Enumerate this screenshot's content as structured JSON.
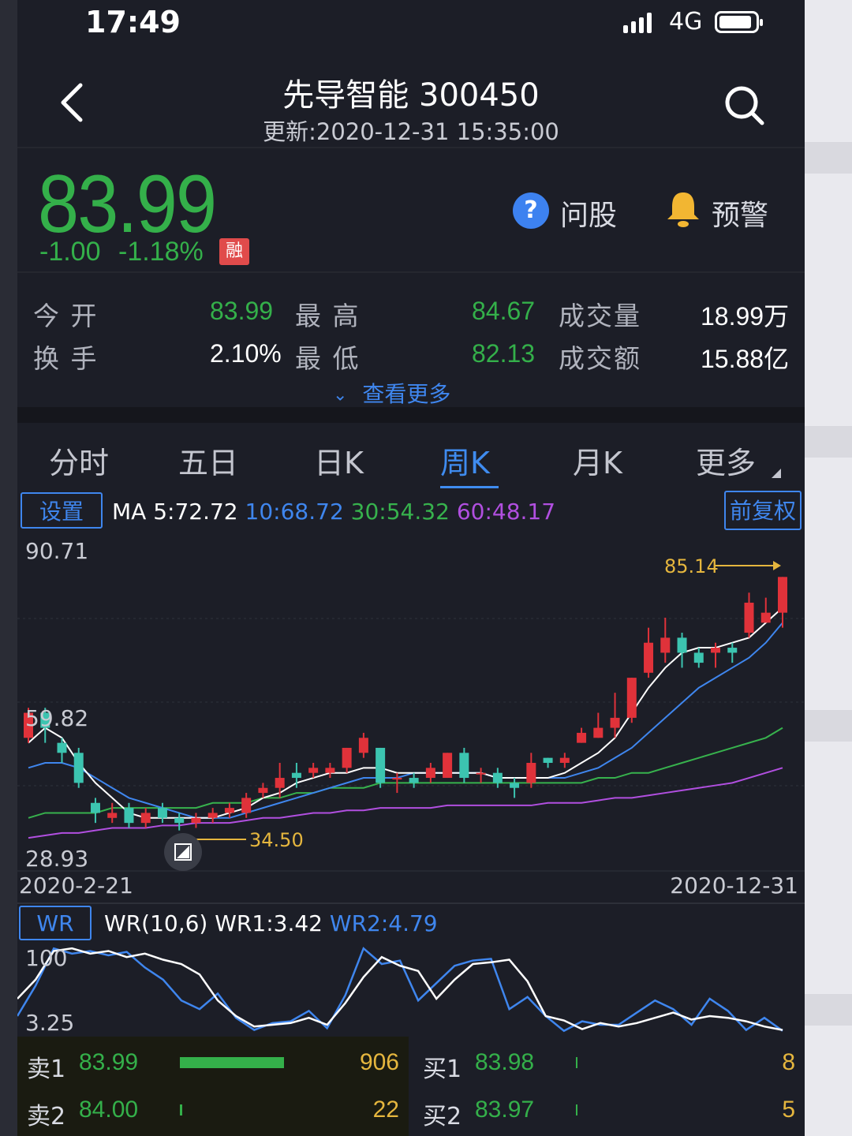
{
  "status_bar": {
    "time": "17:49",
    "network": "4G"
  },
  "header": {
    "title": "先导智能 300450",
    "updated": "更新:2020-12-31 15:35:00"
  },
  "quote": {
    "price": "83.99",
    "change": "-1.00",
    "change_pct": "-1.18%",
    "margin_badge": "融",
    "color_down": "#34b04a"
  },
  "actions": {
    "ask_icon": "?",
    "ask_label": "问股",
    "alert_label": "预警"
  },
  "stats": [
    {
      "label": "今 开",
      "value": "83.99"
    },
    {
      "label": "最 高",
      "value": "84.67"
    },
    {
      "label": "成交量",
      "value": "18.99万"
    },
    {
      "label": "换 手",
      "value": "2.10%"
    },
    {
      "label": "最 低",
      "value": "82.13"
    },
    {
      "label": "成交额",
      "value": "15.88亿"
    }
  ],
  "see_more": "查看更多",
  "tabs": [
    "分时",
    "五日",
    "日K",
    "周K",
    "月K",
    "更多"
  ],
  "active_tab": "周K",
  "toolbar": {
    "settings_label": "设置",
    "adjust_label": "前复权"
  },
  "ma": {
    "prefix": "MA",
    "ma5": "5:72.72",
    "ma10": "10:68.72",
    "ma30": "30:54.32",
    "ma60": "60:48.17",
    "colors": {
      "ma5": "#ffffff",
      "ma10": "#3f86ee",
      "ma30": "#37b24d",
      "ma60": "#b14fe0"
    }
  },
  "chart_data": {
    "type": "candlestick",
    "y_max_label": "90.71",
    "y_mid_label": "59.82",
    "y_min_label": "28.93",
    "ylim": [
      28.93,
      90.71
    ],
    "x_start": "2020-2-21",
    "x_end": "2020-12-31",
    "max_marker": "85.14",
    "min_marker": "34.50",
    "up_color": "#e0323a",
    "down_color": "#3cc4b0",
    "candles": [
      [
        53,
        58,
        52,
        59
      ],
      [
        58,
        55,
        52,
        59
      ],
      [
        52,
        50,
        48,
        53
      ],
      [
        50,
        44,
        43,
        51
      ],
      [
        40,
        38,
        36,
        41
      ],
      [
        37,
        38,
        36,
        40
      ],
      [
        39,
        36,
        35,
        40
      ],
      [
        36,
        38,
        35,
        39
      ],
      [
        39,
        37,
        36,
        40
      ],
      [
        37,
        36,
        34.5,
        38
      ],
      [
        36,
        37,
        35,
        38
      ],
      [
        37,
        38,
        36,
        39
      ],
      [
        38,
        39,
        37,
        40
      ],
      [
        38,
        41,
        37,
        42
      ],
      [
        42,
        43,
        41,
        44
      ],
      [
        43,
        45,
        41,
        48
      ],
      [
        46,
        45,
        43,
        48
      ],
      [
        46,
        47,
        45,
        48
      ],
      [
        46,
        47,
        45,
        48
      ],
      [
        47,
        51,
        46,
        51
      ],
      [
        50,
        53,
        49,
        54
      ],
      [
        51,
        44,
        43,
        51
      ],
      [
        45,
        45,
        42,
        46
      ],
      [
        45,
        44,
        43,
        46
      ],
      [
        45,
        47,
        44,
        48
      ],
      [
        45,
        50,
        45,
        50
      ],
      [
        50,
        45,
        44,
        51
      ],
      [
        46,
        46,
        44,
        47
      ],
      [
        46,
        44,
        43,
        47
      ],
      [
        44,
        43,
        41,
        45
      ],
      [
        44,
        48,
        43,
        50
      ],
      [
        49,
        48,
        47,
        49
      ],
      [
        48,
        49,
        47,
        50
      ],
      [
        52,
        54,
        52,
        55
      ],
      [
        53,
        55,
        53,
        58
      ],
      [
        55,
        57,
        53,
        62
      ],
      [
        57,
        65,
        56,
        65
      ],
      [
        66,
        72,
        65,
        75
      ],
      [
        70,
        73,
        68,
        77
      ],
      [
        73,
        70,
        67,
        74
      ],
      [
        70,
        68,
        67,
        71
      ],
      [
        70,
        71,
        67,
        72
      ],
      [
        71,
        70,
        68,
        72
      ],
      [
        74,
        80,
        73,
        82
      ],
      [
        76,
        78,
        76,
        81
      ],
      [
        78,
        85.14,
        75,
        85.14
      ]
    ],
    "ma5": [
      52,
      55,
      53,
      48,
      44,
      41,
      38,
      37,
      37,
      37,
      37,
      37,
      38,
      39,
      41,
      42,
      44,
      45,
      46,
      46,
      47,
      47,
      46,
      46,
      46,
      46,
      46,
      46,
      45,
      45,
      45,
      45,
      46,
      48,
      50,
      53,
      58,
      63,
      67,
      70,
      71,
      71,
      72,
      73,
      76,
      79
    ],
    "ma10": [
      47,
      48,
      48,
      47,
      45,
      43,
      41,
      40,
      39,
      38,
      37,
      37,
      37,
      38,
      39,
      40,
      41,
      42,
      43,
      44,
      45,
      45,
      45,
      46,
      46,
      46,
      46,
      46,
      45,
      45,
      45,
      45,
      45,
      46,
      47,
      49,
      51,
      54,
      57,
      60,
      63,
      65,
      67,
      69,
      72,
      76
    ],
    "ma30": [
      37,
      38,
      38,
      38,
      38,
      39,
      39,
      39,
      39,
      39,
      39,
      40,
      40,
      40,
      41,
      41,
      42,
      42,
      43,
      43,
      43,
      44,
      44,
      44,
      44,
      44,
      44,
      44,
      44,
      44,
      44,
      44,
      44,
      44,
      45,
      45,
      46,
      46,
      47,
      48,
      49,
      50,
      51,
      52,
      53,
      55
    ],
    "ma60": [
      33,
      33.5,
      34,
      34,
      34.5,
      35,
      35,
      35,
      35.5,
      35.5,
      36,
      36,
      36,
      36.5,
      37,
      37,
      37.5,
      38,
      38,
      38.5,
      38.5,
      39,
      39,
      39,
      39,
      39.5,
      39.5,
      39.5,
      39.5,
      39.5,
      39.5,
      40,
      40,
      40,
      40.5,
      41,
      41,
      41.5,
      42,
      42.5,
      43,
      43.5,
      44,
      45,
      46,
      47
    ]
  },
  "wr": {
    "button_label": "WR",
    "params": "WR(10,6)",
    "wr1": "WR1:3.42",
    "wr2": "WR2:4.79",
    "y_top_label": "100",
    "y_bottom_label": "3.25",
    "wr1_values": [
      40,
      62,
      95,
      98,
      92,
      95,
      88,
      92,
      85,
      80,
      68,
      38,
      20,
      8,
      10,
      12,
      18,
      10,
      35,
      65,
      88,
      78,
      72,
      40,
      62,
      80,
      82,
      85,
      60,
      20,
      15,
      5,
      12,
      8,
      12,
      18,
      24,
      16,
      20,
      18,
      14,
      8,
      4
    ],
    "wr2_values": [
      20,
      55,
      98,
      92,
      95,
      90,
      94,
      76,
      62,
      38,
      28,
      46,
      18,
      4,
      12,
      14,
      26,
      6,
      44,
      98,
      80,
      84,
      38,
      58,
      78,
      84,
      86,
      28,
      42,
      20,
      3,
      14,
      10,
      10,
      24,
      38,
      28,
      10,
      40,
      26,
      4,
      18,
      3
    ],
    "wr1_color": "#ffffff",
    "wr2_color": "#3f86ee"
  },
  "order_book": {
    "sell": [
      {
        "label": "卖1",
        "price": "83.99",
        "volume": "906",
        "bar_fraction": 1.0
      },
      {
        "label": "卖2",
        "price": "84.00",
        "volume": "22",
        "bar_fraction": 0.02
      }
    ],
    "buy": [
      {
        "label": "买1",
        "price": "83.98",
        "volume": "8",
        "bar_fraction": 0.01
      },
      {
        "label": "买2",
        "price": "83.97",
        "volume": "5",
        "bar_fraction": 0.01
      }
    ]
  }
}
